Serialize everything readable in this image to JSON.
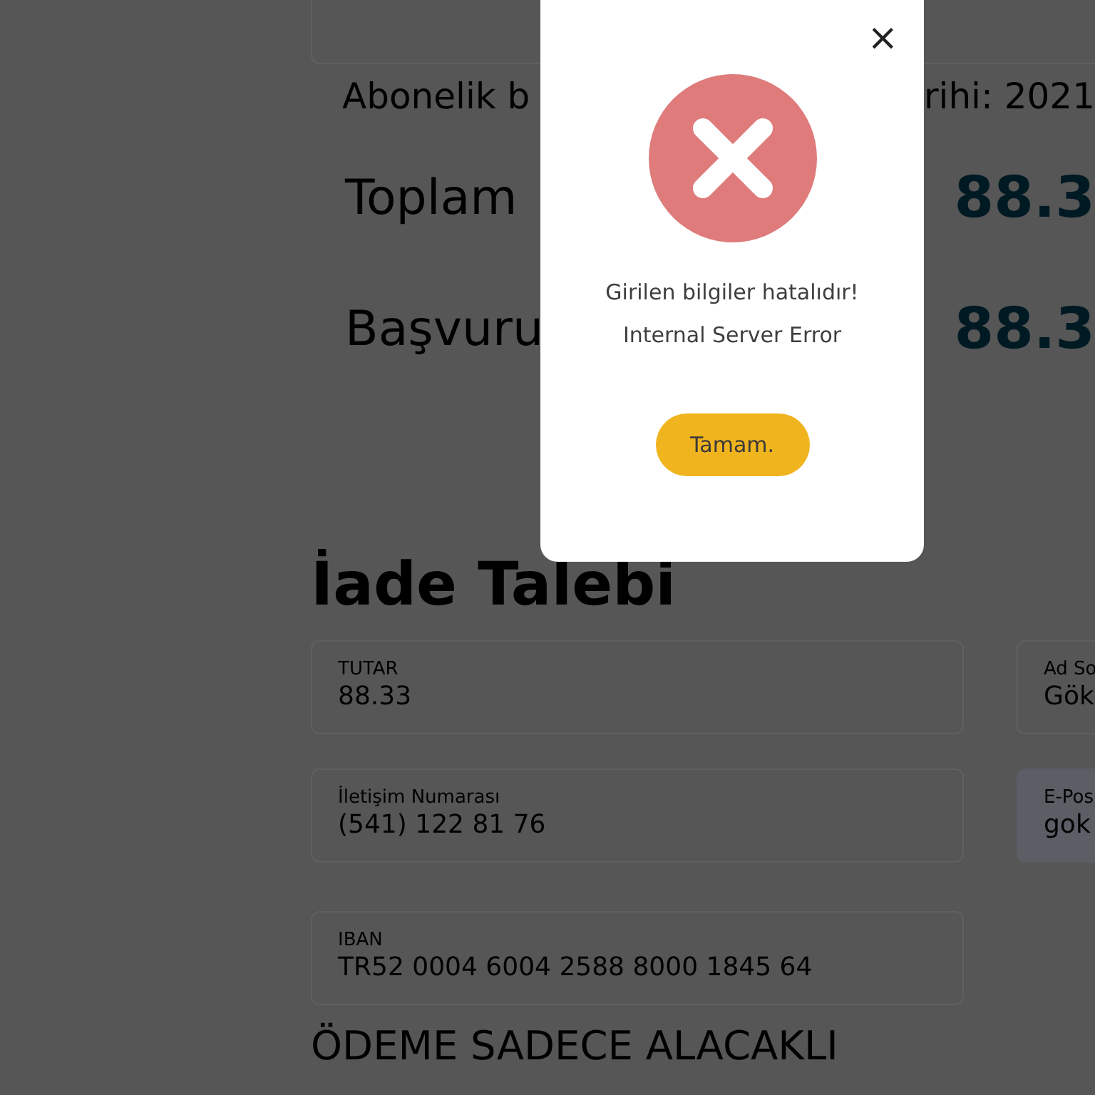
{
  "summary": {
    "subscription_left": "Abonelik b",
    "subscription_right": "rihi: 2021",
    "rows": [
      {
        "label": "Toplam",
        "value": "88.3"
      },
      {
        "label": "Başvuru",
        "value": "88.3"
      }
    ]
  },
  "refund": {
    "title": "İade Talebi",
    "fields": [
      {
        "label": "TUTAR",
        "value": "88.33",
        "kind": "plain"
      },
      {
        "label": "Ad So",
        "value": "Gök",
        "kind": "plain"
      },
      {
        "label": "İletişim Numarası",
        "value": "(541) 122 81 76",
        "kind": "plain"
      },
      {
        "label": "E-Pos",
        "value": "gok",
        "kind": "focused"
      },
      {
        "label": "IBAN",
        "value": "TR52 0004 6004 2588 8000 1845 64",
        "kind": "plain"
      }
    ],
    "note": "ÖDEME SADECE ALACAKLI"
  },
  "dialog": {
    "close": "×",
    "message": "Girilen bilgiler hatalıdır!",
    "detail": "Internal Server Error",
    "button": "Tamam."
  }
}
